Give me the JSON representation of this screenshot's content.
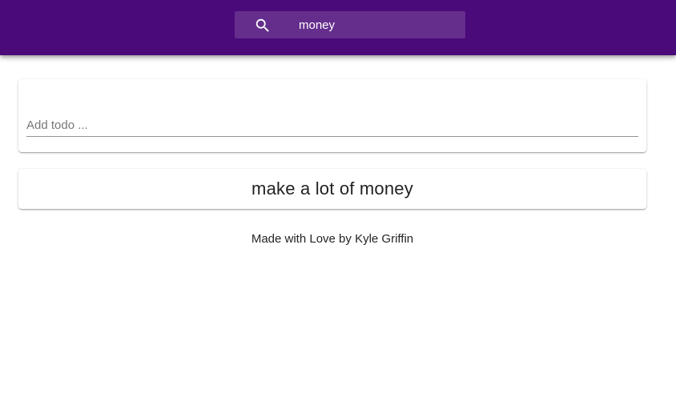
{
  "header": {
    "search": {
      "icon": "search-icon",
      "value": "money",
      "background": "#4a0a7a"
    }
  },
  "add_todo": {
    "placeholder": "Add todo ..."
  },
  "todos": [
    {
      "text": "make a lot of money"
    }
  ],
  "footer": {
    "text": "Made with Love by Kyle Griffin"
  }
}
